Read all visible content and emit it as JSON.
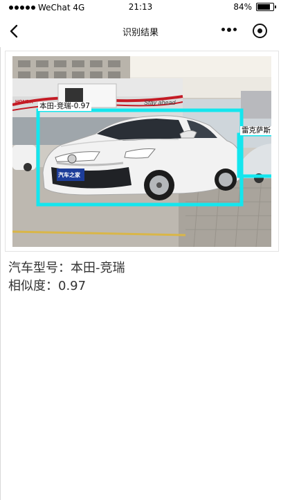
{
  "status_bar": {
    "carrier": "WeChat",
    "network": "4G",
    "time": "21:13",
    "battery": "84%",
    "battery_level": 0.84
  },
  "nav": {
    "title": "识别结果"
  },
  "photo": {
    "detections": [
      {
        "label": "本田-竞瑞-0.97"
      },
      {
        "label": "雷克萨斯"
      }
    ],
    "dealer_sign": "Stay ahead",
    "brand_banner": "HONDA",
    "plate_text": "汽车之家"
  },
  "result": {
    "model_label": "汽车型号：",
    "model_value": "本田-竞瑞",
    "similarity_label": "相似度：",
    "similarity_value": "0.97"
  },
  "colors": {
    "box": "#14e6ee",
    "car": "#f2f2f2",
    "text": "#333333"
  }
}
